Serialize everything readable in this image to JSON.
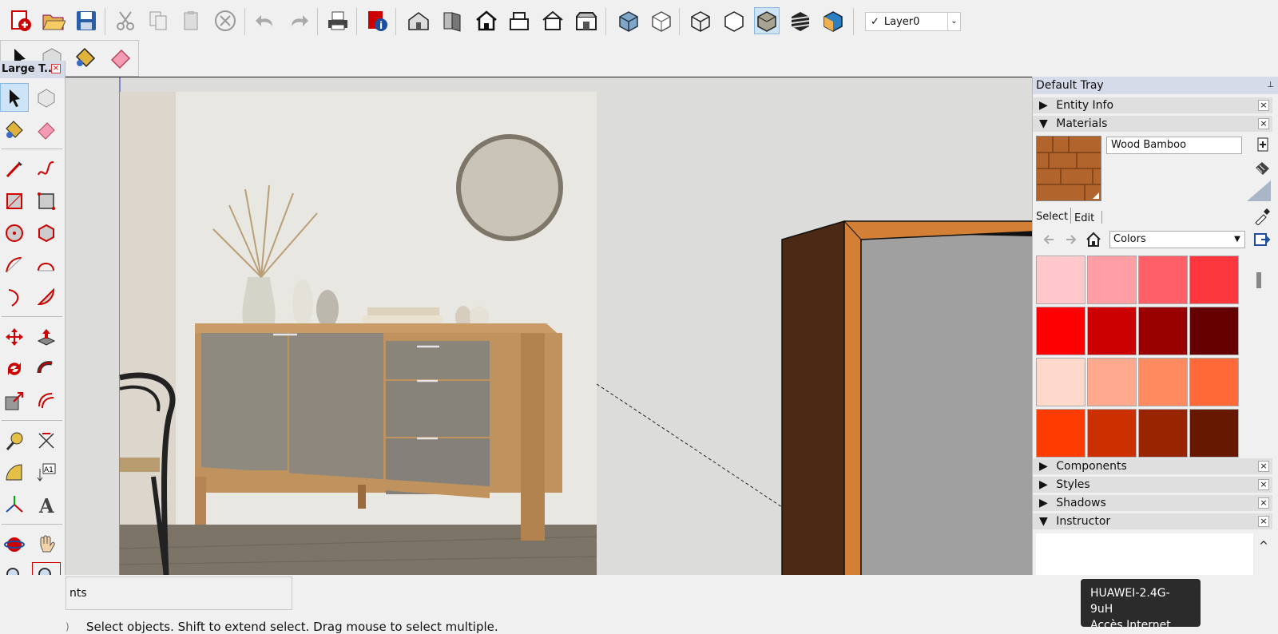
{
  "toolbar": {
    "layer_label": "Layer0",
    "layer_check": "✓"
  },
  "left_panel": {
    "title": "Large T..."
  },
  "tray": {
    "title": "Default Tray",
    "sections": {
      "entity_info": "Entity Info",
      "materials": "Materials",
      "components": "Components",
      "styles": "Styles",
      "shadows": "Shadows",
      "instructor": "Instructor"
    },
    "material_name": "Wood Bamboo",
    "tabs": {
      "select": "Select",
      "edit": "Edit"
    },
    "collection": "Colors",
    "swatch_colors": [
      "#ffc9cc",
      "#ff9fa5",
      "#ff6068",
      "#fb363d",
      "#ff0000",
      "#cc0000",
      "#990000",
      "#660000",
      "#ffd8cc",
      "#ffa98e",
      "#ff8a60",
      "#ff6837",
      "#ff3c00",
      "#cc3000",
      "#992400",
      "#661800"
    ]
  },
  "status": {
    "measurement_label": "nts",
    "message": "Select objects. Shift to extend select. Drag mouse to select multiple."
  },
  "tooltip": {
    "line1": "HUAWEI-2.4G-9uH",
    "line2": "Accès Internet"
  }
}
